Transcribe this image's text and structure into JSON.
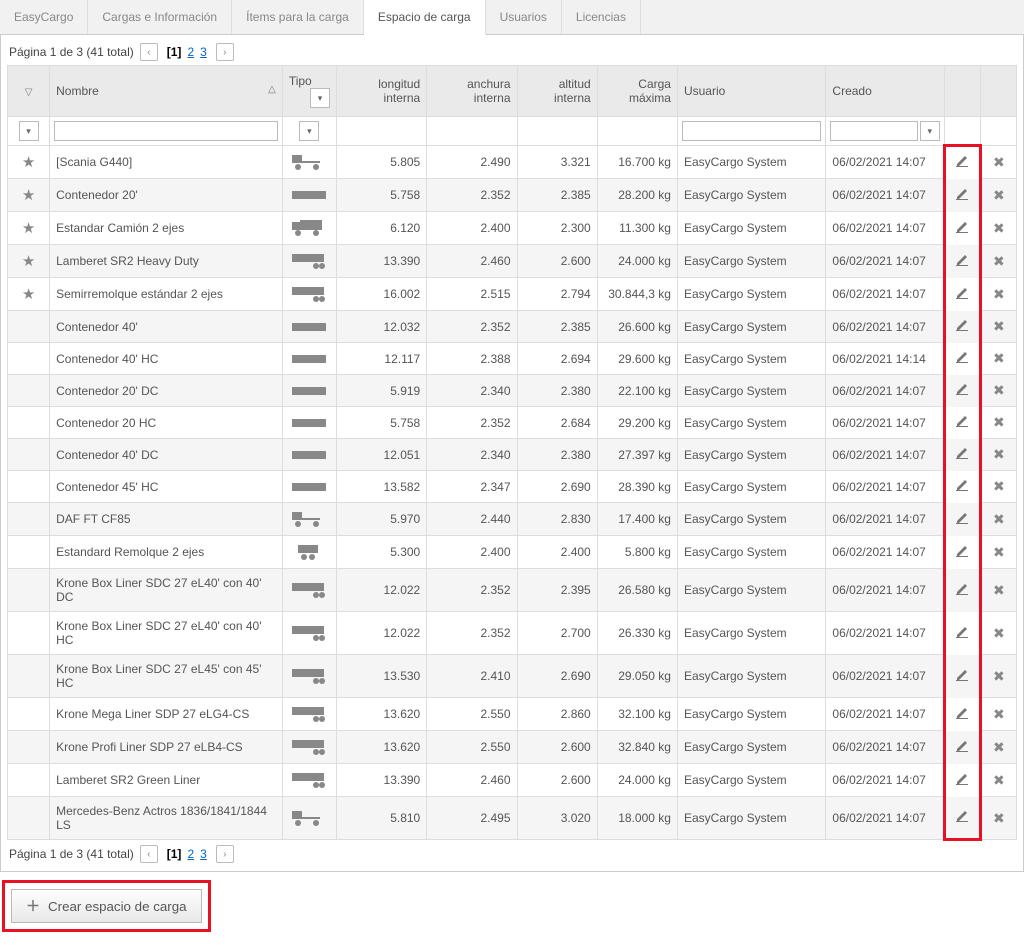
{
  "tabs": [
    "EasyCargo",
    "Cargas e Información",
    "Ítems para la carga",
    "Espacio de carga",
    "Usuarios",
    "Licencias"
  ],
  "activeTab": 3,
  "pager": {
    "text": "Página 1 de 3 (41 total)",
    "pages": [
      "[1]",
      "2",
      "3"
    ],
    "current": 0
  },
  "columns": {
    "nombre": "Nombre",
    "tipo": "Tipo",
    "longitud": "longitud interna",
    "anchura": "anchura interna",
    "altitud": "altitud interna",
    "carga": "Carga máxima",
    "usuario": "Usuario",
    "creado": "Creado"
  },
  "createLabel": "Crear espacio de carga",
  "rows": [
    {
      "fav": true,
      "name": "[Scania G440]",
      "type": "truck",
      "li": "5.805",
      "ai": "2.490",
      "alt": "3.321",
      "cm": "16.700 kg",
      "user": "EasyCargo System",
      "date": "06/02/2021 14:07"
    },
    {
      "fav": true,
      "name": "Contenedor 20'",
      "type": "container",
      "li": "5.758",
      "ai": "2.352",
      "alt": "2.385",
      "cm": "28.200 kg",
      "user": "EasyCargo System",
      "date": "06/02/2021 14:07"
    },
    {
      "fav": true,
      "name": "Estandar Camión 2 ejes",
      "type": "boxtruck",
      "li": "6.120",
      "ai": "2.400",
      "alt": "2.300",
      "cm": "11.300 kg",
      "user": "EasyCargo System",
      "date": "06/02/2021 14:07"
    },
    {
      "fav": true,
      "name": "Lamberet SR2 Heavy Duty",
      "type": "trailer",
      "li": "13.390",
      "ai": "2.460",
      "alt": "2.600",
      "cm": "24.000 kg",
      "user": "EasyCargo System",
      "date": "06/02/2021 14:07"
    },
    {
      "fav": true,
      "name": "Semirremolque estándar 2 ejes",
      "type": "trailer",
      "li": "16.002",
      "ai": "2.515",
      "alt": "2.794",
      "cm": "30.844,3 kg",
      "user": "EasyCargo System",
      "date": "06/02/2021 14:07"
    },
    {
      "fav": false,
      "name": "Contenedor 40'",
      "type": "container",
      "li": "12.032",
      "ai": "2.352",
      "alt": "2.385",
      "cm": "26.600 kg",
      "user": "EasyCargo System",
      "date": "06/02/2021 14:07"
    },
    {
      "fav": false,
      "name": "Contenedor 40' HC",
      "type": "container",
      "li": "12.117",
      "ai": "2.388",
      "alt": "2.694",
      "cm": "29.600 kg",
      "user": "EasyCargo System",
      "date": "06/02/2021 14:14"
    },
    {
      "fav": false,
      "name": "Contenedor 20' DC",
      "type": "container",
      "li": "5.919",
      "ai": "2.340",
      "alt": "2.380",
      "cm": "22.100 kg",
      "user": "EasyCargo System",
      "date": "06/02/2021 14:07"
    },
    {
      "fav": false,
      "name": "Contenedor 20 HC",
      "type": "container",
      "li": "5.758",
      "ai": "2.352",
      "alt": "2.684",
      "cm": "29.200 kg",
      "user": "EasyCargo System",
      "date": "06/02/2021 14:07"
    },
    {
      "fav": false,
      "name": "Contenedor 40' DC",
      "type": "container",
      "li": "12.051",
      "ai": "2.340",
      "alt": "2.380",
      "cm": "27.397 kg",
      "user": "EasyCargo System",
      "date": "06/02/2021 14:07"
    },
    {
      "fav": false,
      "name": "Contenedor 45' HC",
      "type": "container",
      "li": "13.582",
      "ai": "2.347",
      "alt": "2.690",
      "cm": "28.390 kg",
      "user": "EasyCargo System",
      "date": "06/02/2021 14:07"
    },
    {
      "fav": false,
      "name": "DAF FT CF85",
      "type": "truck",
      "li": "5.970",
      "ai": "2.440",
      "alt": "2.830",
      "cm": "17.400 kg",
      "user": "EasyCargo System",
      "date": "06/02/2021 14:07"
    },
    {
      "fav": false,
      "name": "Estandard Remolque 2 ejes",
      "type": "smalltrailer",
      "li": "5.300",
      "ai": "2.400",
      "alt": "2.400",
      "cm": "5.800 kg",
      "user": "EasyCargo System",
      "date": "06/02/2021 14:07"
    },
    {
      "fav": false,
      "name": "Krone Box Liner SDC 27 eL40' con 40' DC",
      "type": "trailer",
      "li": "12.022",
      "ai": "2.352",
      "alt": "2.395",
      "cm": "26.580 kg",
      "user": "EasyCargo System",
      "date": "06/02/2021 14:07"
    },
    {
      "fav": false,
      "name": "Krone Box Liner SDC 27 eL40' con 40' HC",
      "type": "trailer",
      "li": "12.022",
      "ai": "2.352",
      "alt": "2.700",
      "cm": "26.330 kg",
      "user": "EasyCargo System",
      "date": "06/02/2021 14:07"
    },
    {
      "fav": false,
      "name": "Krone Box Liner SDC 27 eL45' con 45' HC",
      "type": "trailer",
      "li": "13.530",
      "ai": "2.410",
      "alt": "2.690",
      "cm": "29.050 kg",
      "user": "EasyCargo System",
      "date": "06/02/2021 14:07"
    },
    {
      "fav": false,
      "name": "Krone Mega Liner SDP 27 eLG4-CS",
      "type": "trailer",
      "li": "13.620",
      "ai": "2.550",
      "alt": "2.860",
      "cm": "32.100 kg",
      "user": "EasyCargo System",
      "date": "06/02/2021 14:07"
    },
    {
      "fav": false,
      "name": "Krone Profi Liner SDP 27 eLB4-CS",
      "type": "trailer",
      "li": "13.620",
      "ai": "2.550",
      "alt": "2.600",
      "cm": "32.840 kg",
      "user": "EasyCargo System",
      "date": "06/02/2021 14:07"
    },
    {
      "fav": false,
      "name": "Lamberet SR2 Green Liner",
      "type": "trailer",
      "li": "13.390",
      "ai": "2.460",
      "alt": "2.600",
      "cm": "24.000 kg",
      "user": "EasyCargo System",
      "date": "06/02/2021 14:07"
    },
    {
      "fav": false,
      "name": "Mercedes-Benz Actros 1836/1841/1844 LS",
      "type": "truck",
      "li": "5.810",
      "ai": "2.495",
      "alt": "3.020",
      "cm": "18.000 kg",
      "user": "EasyCargo System",
      "date": "06/02/2021 14:07"
    }
  ]
}
